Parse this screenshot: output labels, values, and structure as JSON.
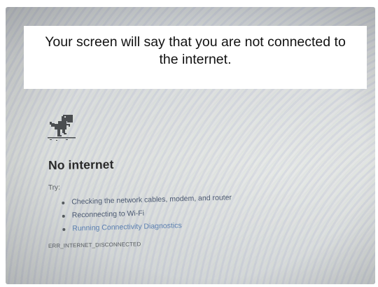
{
  "caption": {
    "text": "Your screen will say that you are not connected to the internet."
  },
  "offline_page": {
    "icon": "dinosaur-icon",
    "title": "No internet",
    "try_label": "Try:",
    "suggestions": [
      {
        "label": "Checking the network cables, modem, and router",
        "is_link": false
      },
      {
        "label": "Reconnecting to Wi-Fi",
        "is_link": false
      },
      {
        "label": "Running Connectivity Diagnostics",
        "is_link": true
      }
    ],
    "error_code": "ERR_INTERNET_DISCONNECTED"
  },
  "colors": {
    "title_text": "#2a2a2a",
    "body_text": "#555a5e",
    "link_text": "#5a7fb0",
    "caption_bg": "#ffffff"
  }
}
